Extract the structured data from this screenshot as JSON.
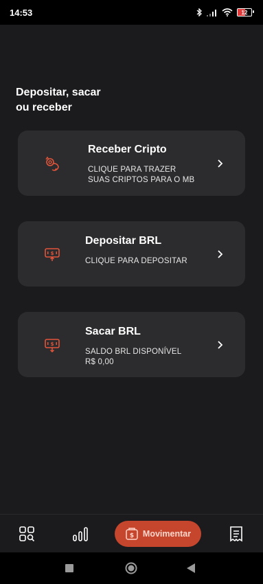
{
  "status_bar": {
    "time": "14:53",
    "battery": "12"
  },
  "page": {
    "title": "Depositar, sacar\nou receber"
  },
  "cards": [
    {
      "title": "Receber Cripto",
      "line1": "CLIQUE PARA TRAZER",
      "line2": "SUAS CRIPTOS PARA O MB",
      "icon": "crypto-receive-icon"
    },
    {
      "title": "Depositar BRL",
      "line1": "CLIQUE PARA DEPOSITAR",
      "icon": "deposit-brl-icon"
    },
    {
      "title": "Sacar BRL",
      "line1": "SALDO BRL DISPONÍVEL",
      "line2": "R$ 0,00",
      "icon": "withdraw-brl-icon"
    }
  ],
  "bottom_nav": {
    "movimentar_label": "Movimentar"
  },
  "colors": {
    "accent": "#e2553a",
    "button": "#c6452d",
    "card": "#2c2c2e",
    "background": "#1b1b1d"
  }
}
